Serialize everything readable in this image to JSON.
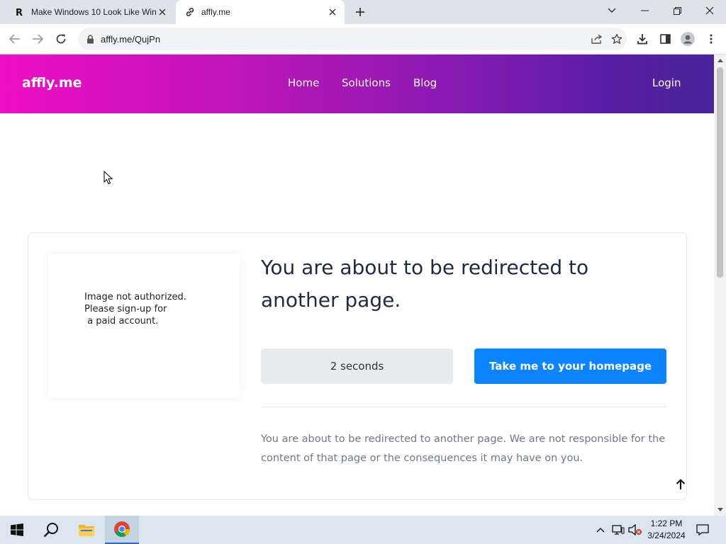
{
  "browser": {
    "tabs": [
      {
        "title": "Make Windows 10 Look Like Win",
        "favicon": "R"
      },
      {
        "title": "affly.me"
      }
    ],
    "url": "affly.me/QujPn"
  },
  "site": {
    "brand": "affly.me",
    "nav": [
      "Home",
      "Solutions",
      "Blog"
    ],
    "login": "Login"
  },
  "card": {
    "image_text": "Image not authorized.\nPlease sign-up for\n a paid account.",
    "headline": "You are about to be redirected to another page.",
    "countdown": "2 seconds",
    "cta": "Take me to your homepage",
    "notice": "You are about to be redirected to another page. We are not responsible for the content of that page or the consequences it may have on you."
  },
  "taskbar": {
    "time": "1:22 PM",
    "date": "3/24/2024"
  },
  "colors": {
    "header_gradient_start": "#ee0fc2",
    "header_gradient_end": "#4b249c",
    "cta": "#0d84ff",
    "headline": "#1f2a44"
  }
}
